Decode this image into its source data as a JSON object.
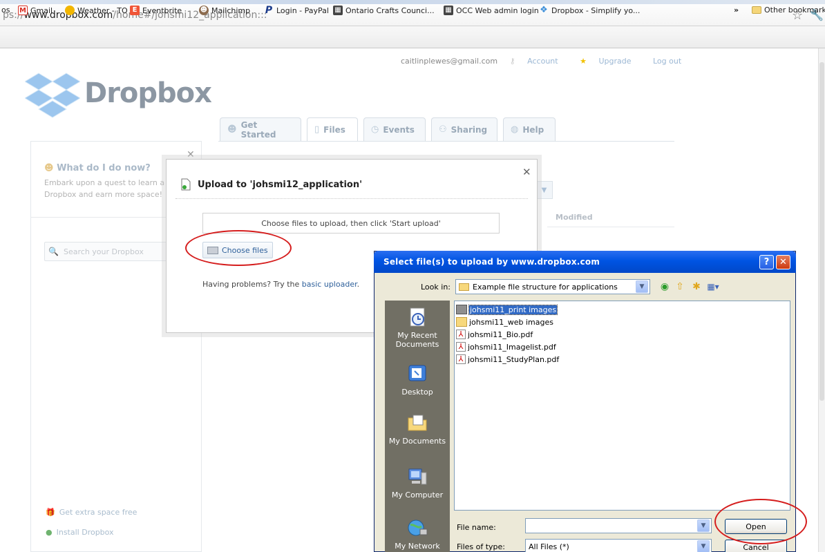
{
  "browser": {
    "url_dim": "ps://",
    "url_main": "www.dropbox.com",
    "url_path": "/home#/johsmi12_application:::",
    "bookmarks": [
      {
        "label": "Gmail",
        "icon": "gmail-icon",
        "color": "#d93025",
        "glyph": "M"
      },
      {
        "label": "Weather - TO",
        "icon": "weather-icon",
        "color": "#f2b600",
        "glyph": "●"
      },
      {
        "label": "Eventbrite",
        "icon": "eventbrite-icon",
        "color": "#f05537",
        "glyph": "E"
      },
      {
        "label": "Mailchimp",
        "icon": "mailchimp-icon",
        "color": "#5a4a3a",
        "glyph": "☻"
      },
      {
        "label": "Login - PayPal",
        "icon": "paypal-icon",
        "color": "#1c3c8c",
        "glyph": "P"
      },
      {
        "label": "Ontario Crafts Counci...",
        "icon": "occ-icon",
        "color": "#555",
        "glyph": "▦"
      },
      {
        "label": "OCC Web admin login",
        "icon": "occ-icon",
        "color": "#555",
        "glyph": "▦"
      },
      {
        "label": "Dropbox - Simplify yo...",
        "icon": "dropbox-icon",
        "color": "#3d8fd9",
        "glyph": "❖"
      }
    ],
    "bookmarks_prefix": "os",
    "overflow": "»",
    "other_bookmarks": "Other bookmarks"
  },
  "dropbox": {
    "email": "caitlinplewes@gmail.com",
    "account": "Account",
    "upgrade": "Upgrade",
    "logout": "Log out",
    "logo": "Dropbox",
    "tabs": [
      "Get Started",
      "Files",
      "Events",
      "Sharing",
      "Help"
    ],
    "sidebar": {
      "what_title": "What do I do now?",
      "what_line1": "Embark upon a quest to learn a",
      "what_line2": "Dropbox and earn more space!",
      "search_placeholder": "Search your Dropbox",
      "extra_space": "Get extra space free",
      "install": "Install Dropbox"
    },
    "modified_col": "Modified"
  },
  "upload_dialog": {
    "title": "Upload to 'johsmi12_application'",
    "instruction": "Choose files to upload, then click 'Start upload'",
    "choose_files": "Choose files",
    "problems_text": "Having problems? Try the ",
    "basic_uploader": "basic uploader",
    "problems_end": "."
  },
  "file_dialog": {
    "title": "Select file(s) to upload by www.dropbox.com",
    "look_in_label": "Look in:",
    "look_in_value": "Example file structure for applications",
    "places": [
      "My Recent Documents",
      "Desktop",
      "My Documents",
      "My Computer",
      "My Network"
    ],
    "files": [
      {
        "name": "johsmi11_print images",
        "type": "folder",
        "selected": true
      },
      {
        "name": "johsmi11_web images",
        "type": "folder",
        "selected": false
      },
      {
        "name": "johsmi11_Bio.pdf",
        "type": "pdf",
        "selected": false
      },
      {
        "name": "johsmi11_Imagelist.pdf",
        "type": "pdf",
        "selected": false
      },
      {
        "name": "johsmi11_StudyPlan.pdf",
        "type": "pdf",
        "selected": false
      }
    ],
    "file_name_label": "File name:",
    "file_name_value": "",
    "files_of_type_label": "Files of type:",
    "files_of_type_value": "All Files (*)",
    "open": "Open",
    "cancel": "Cancel"
  }
}
